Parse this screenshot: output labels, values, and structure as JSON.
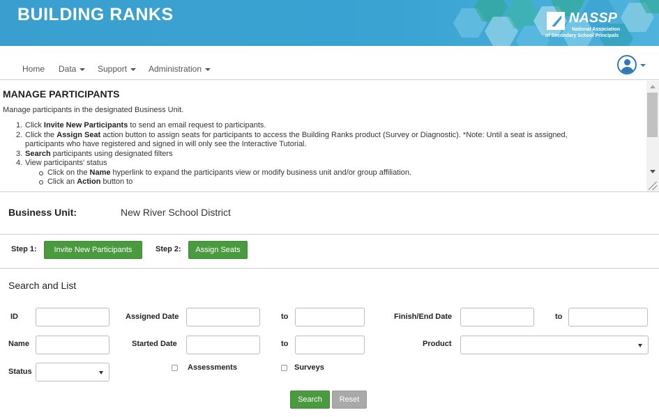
{
  "header": {
    "title": "BUILDING RANKS",
    "logo": {
      "name": "NASSP",
      "subtitle_line1": "National Association",
      "subtitle_line2": "of Secondary School Principals"
    },
    "colors": {
      "banner": "#3a9fcf",
      "hex_light": "#8fd0e6",
      "hex_teal": "#2fa88c"
    }
  },
  "nav": {
    "items": [
      {
        "label": "Home",
        "has_dropdown": false
      },
      {
        "label": "Data",
        "has_dropdown": true
      },
      {
        "label": "Support",
        "has_dropdown": true
      },
      {
        "label": "Administration",
        "has_dropdown": true
      }
    ],
    "user_icon": "user-circle-icon"
  },
  "instructions": {
    "title": "MANAGE PARTICIPANTS",
    "description": "Manage participants in the designated Business Unit.",
    "steps": {
      "s1_num": "1.",
      "s1_pre": "Click ",
      "s1_bold": "Invite New Participants",
      "s1_post": " to send an email request to participants.",
      "s2_num": "2.",
      "s2_pre": "Click the ",
      "s2_bold": "Assign Seat",
      "s2_post": " action button to assign seats for participants to access the Building Ranks product (Survey or Diagnostic). *Note: Until a seat is assigned,",
      "s2_cont": "participants who have registered and signed in will only see the Interactive Tutorial.",
      "s3_num": "3.",
      "s3_bold": "Search",
      "s3_post": " participants using designated filters",
      "s4_num": "4.",
      "s4_text": "View participants' status",
      "s4a_pre": "Click on the ",
      "s4a_bold": "Name",
      "s4a_post": " hyperlink to expand the participants view or modify business unit and/or group affiliation.",
      "s4b_pre": "Click an ",
      "s4b_bold": "Action",
      "s4b_post": " button to"
    }
  },
  "business_unit": {
    "label": "Business Unit:",
    "value": "New River School District"
  },
  "steps_bar": {
    "step1_label": "Step 1:",
    "step1_button": "Invite New Participants",
    "step2_label": "Step 2:",
    "step2_button": "Assign Seats"
  },
  "search": {
    "title": "Search and List",
    "labels": {
      "id": "ID",
      "assigned_date": "Assigned Date",
      "to": "to",
      "finish_end_date": "Finish/End Date",
      "name": "Name",
      "started_date": "Started Date",
      "product": "Product",
      "status": "Status",
      "assessments": "Assessments",
      "surveys": "Surveys"
    },
    "values": {
      "id": "",
      "assigned_from": "",
      "assigned_to": "",
      "finish_from": "",
      "finish_to": "",
      "name": "",
      "started_from": "",
      "started_to": "",
      "product": "",
      "status": ""
    },
    "checkboxes": {
      "assessments": false,
      "surveys": false
    },
    "search_button": "Search",
    "reset_button": "Reset"
  }
}
